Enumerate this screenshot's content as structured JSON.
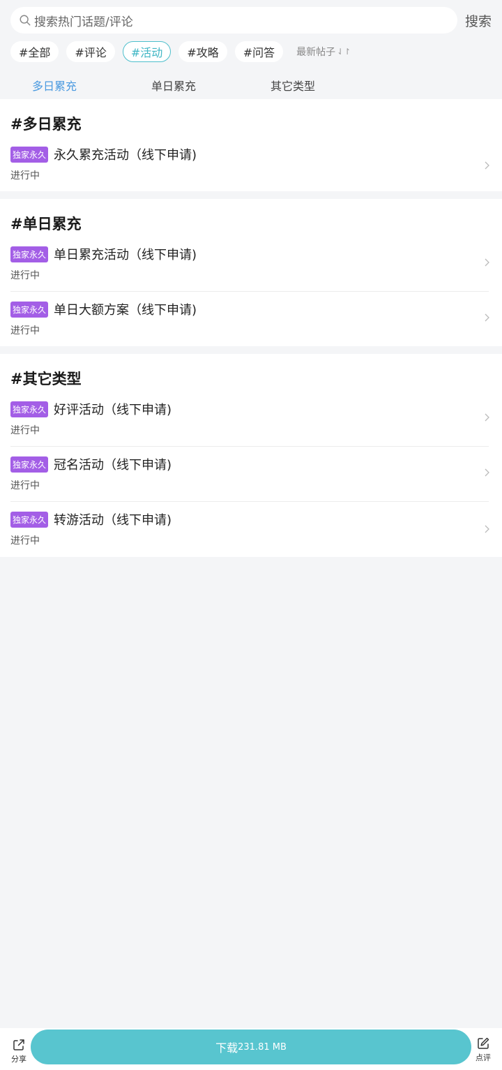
{
  "search": {
    "placeholder": "搜索热门话题/评论",
    "button_label": "搜索"
  },
  "tags": [
    {
      "label": "#全部",
      "active": false
    },
    {
      "label": "#评论",
      "active": false
    },
    {
      "label": "#活动",
      "active": true
    },
    {
      "label": "#攻略",
      "active": false
    },
    {
      "label": "#问答",
      "active": false
    }
  ],
  "sort": {
    "label": "最新帖子",
    "icon": "sort-arrows-icon"
  },
  "subtabs": [
    {
      "label": "多日累充",
      "active": true
    },
    {
      "label": "单日累充",
      "active": false
    },
    {
      "label": "其它类型",
      "active": false
    }
  ],
  "sections": [
    {
      "title": "#多日累充",
      "items": [
        {
          "badge": "独家永久",
          "title": "永久累充活动（线下申请)",
          "status": "进行中"
        }
      ]
    },
    {
      "title": "#单日累充",
      "items": [
        {
          "badge": "独家永久",
          "title": "单日累充活动（线下申请)",
          "status": "进行中"
        },
        {
          "badge": "独家永久",
          "title": "单日大额方案（线下申请)",
          "status": "进行中"
        }
      ]
    },
    {
      "title": "#其它类型",
      "items": [
        {
          "badge": "独家永久",
          "title": "好评活动（线下申请)",
          "status": "进行中"
        },
        {
          "badge": "独家永久",
          "title": "冠名活动（线下申请)",
          "status": "进行中"
        },
        {
          "badge": "独家永久",
          "title": "转游活动（线下申请)",
          "status": "进行中"
        }
      ]
    }
  ],
  "bottom": {
    "share_label": "分享",
    "download_label": "下载",
    "download_size": "231.81 MB",
    "review_label": "点评"
  },
  "colors": {
    "accent": "#58c5cf",
    "badge": "#a35ee6",
    "active_subtab": "#4a9ae0",
    "active_tag_border": "#4dbfcc"
  }
}
